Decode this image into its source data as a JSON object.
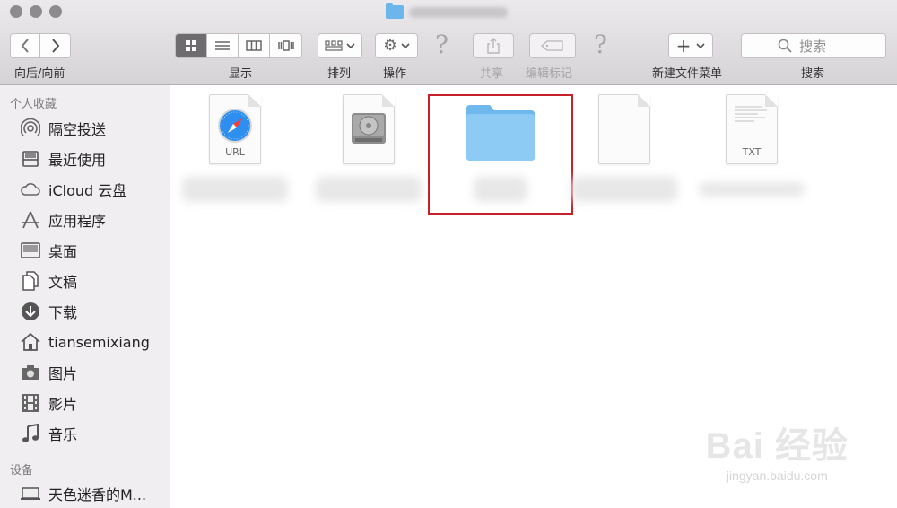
{
  "toolbar": {
    "nav_label": "向后/向前",
    "view_label": "显示",
    "arrange_label": "排列",
    "action_label": "操作",
    "share_label": "共享",
    "edit_tags_label": "编辑标记",
    "new_folder_menu_label": "新建文件菜单",
    "search_label": "搜索",
    "search_placeholder": "搜索"
  },
  "sidebar": {
    "favorites_header": "个人收藏",
    "favorites": [
      {
        "label": "隔空投送",
        "icon": "airdrop-icon"
      },
      {
        "label": "最近使用",
        "icon": "recents-icon"
      },
      {
        "label": "iCloud 云盘",
        "icon": "icloud-icon"
      },
      {
        "label": "应用程序",
        "icon": "applications-icon"
      },
      {
        "label": "桌面",
        "icon": "desktop-icon"
      },
      {
        "label": "文稿",
        "icon": "documents-icon"
      },
      {
        "label": "下载",
        "icon": "downloads-icon"
      },
      {
        "label": "tiansemixiang",
        "icon": "home-icon"
      },
      {
        "label": "图片",
        "icon": "camera-icon"
      },
      {
        "label": "影片",
        "icon": "film-icon"
      },
      {
        "label": "音乐",
        "icon": "music-icon"
      }
    ],
    "devices_header": "设备",
    "devices": [
      {
        "label": "天色迷香的M...",
        "icon": "laptop-icon"
      }
    ]
  },
  "files": [
    {
      "kind": "url",
      "tag": "URL",
      "icon": "safari-url-icon"
    },
    {
      "kind": "disk-image",
      "tag": "",
      "icon": "disk-image-icon"
    },
    {
      "kind": "folder",
      "tag": "",
      "icon": "folder-icon",
      "selected": true
    },
    {
      "kind": "blank",
      "tag": "",
      "icon": "blank-document-icon"
    },
    {
      "kind": "txt",
      "tag": "TXT",
      "icon": "txt-document-icon"
    }
  ],
  "watermark": {
    "brand": "Bai 经验",
    "url": "jingyan.baidu.com"
  },
  "colors": {
    "selection_border": "#c8202a",
    "folder_blue": "#7fc1ef",
    "sidebar_bg": "#f0eef0"
  }
}
